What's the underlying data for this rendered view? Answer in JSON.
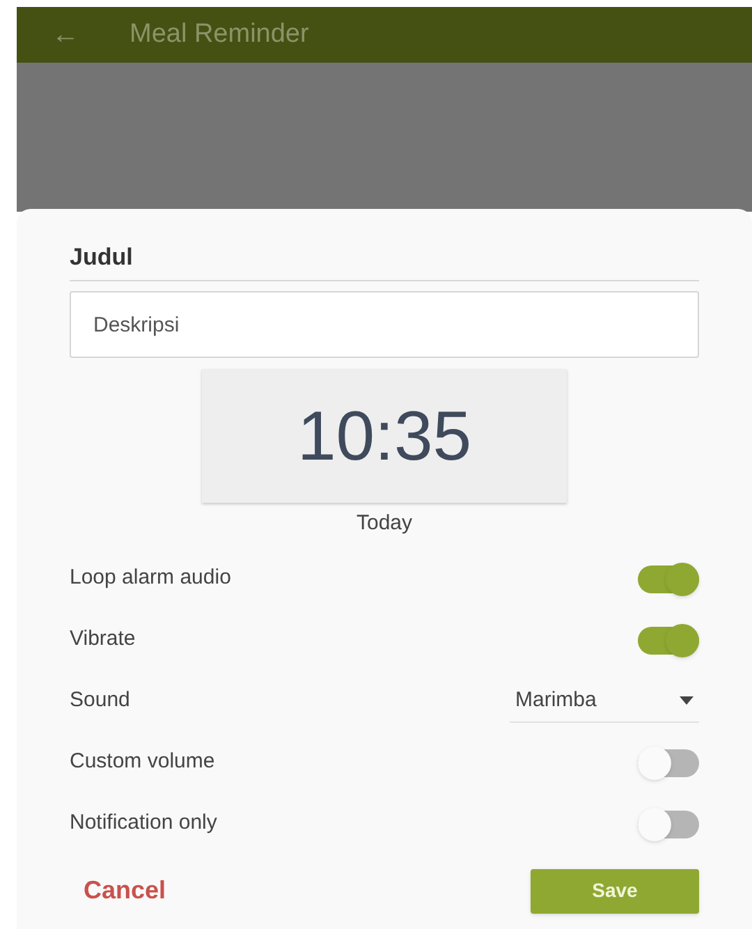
{
  "app_bar": {
    "back": "←",
    "title": "Meal Reminder"
  },
  "dialog": {
    "title_field": {
      "placeholder": "Judul"
    },
    "description_field": {
      "placeholder": "Deskripsi"
    },
    "time": "10:35",
    "date": "Today",
    "settings": [
      {
        "kind": "toggle",
        "label": "Loop alarm audio",
        "on": true
      },
      {
        "kind": "toggle",
        "label": "Vibrate",
        "on": true
      },
      {
        "kind": "dropdown",
        "label": "Sound",
        "value": "Marimba"
      },
      {
        "kind": "toggle",
        "label": "Custom volume",
        "on": false
      },
      {
        "kind": "toggle",
        "label": "Notification only",
        "on": false
      }
    ],
    "buttons": {
      "cancel": "Cancel",
      "save": "Save"
    }
  }
}
